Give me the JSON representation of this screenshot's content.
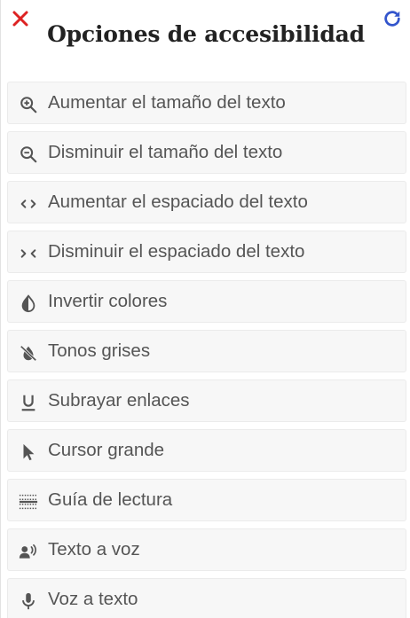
{
  "header": {
    "title": "Opciones de accesibilidad",
    "close_icon": "close-icon",
    "reset_icon": "refresh-icon",
    "close_color": "#dd2222",
    "reset_color": "#3355cc"
  },
  "options": [
    {
      "label": "Aumentar el tamaño del texto",
      "icon": "zoom-in-icon"
    },
    {
      "label": "Disminuir el tamaño del texto",
      "icon": "zoom-out-icon"
    },
    {
      "label": "Aumentar el espaciado del texto",
      "icon": "expand-spacing-icon"
    },
    {
      "label": "Disminuir el espaciado del texto",
      "icon": "contract-spacing-icon"
    },
    {
      "label": "Invertir colores",
      "icon": "invert-colors-icon"
    },
    {
      "label": "Tonos grises",
      "icon": "grayscale-icon"
    },
    {
      "label": "Subrayar enlaces",
      "icon": "underline-icon"
    },
    {
      "label": "Cursor grande",
      "icon": "cursor-icon"
    },
    {
      "label": "Guía de lectura",
      "icon": "reading-guide-icon"
    },
    {
      "label": "Texto a voz",
      "icon": "speaker-icon"
    },
    {
      "label": "Voz a texto",
      "icon": "microphone-icon"
    }
  ]
}
